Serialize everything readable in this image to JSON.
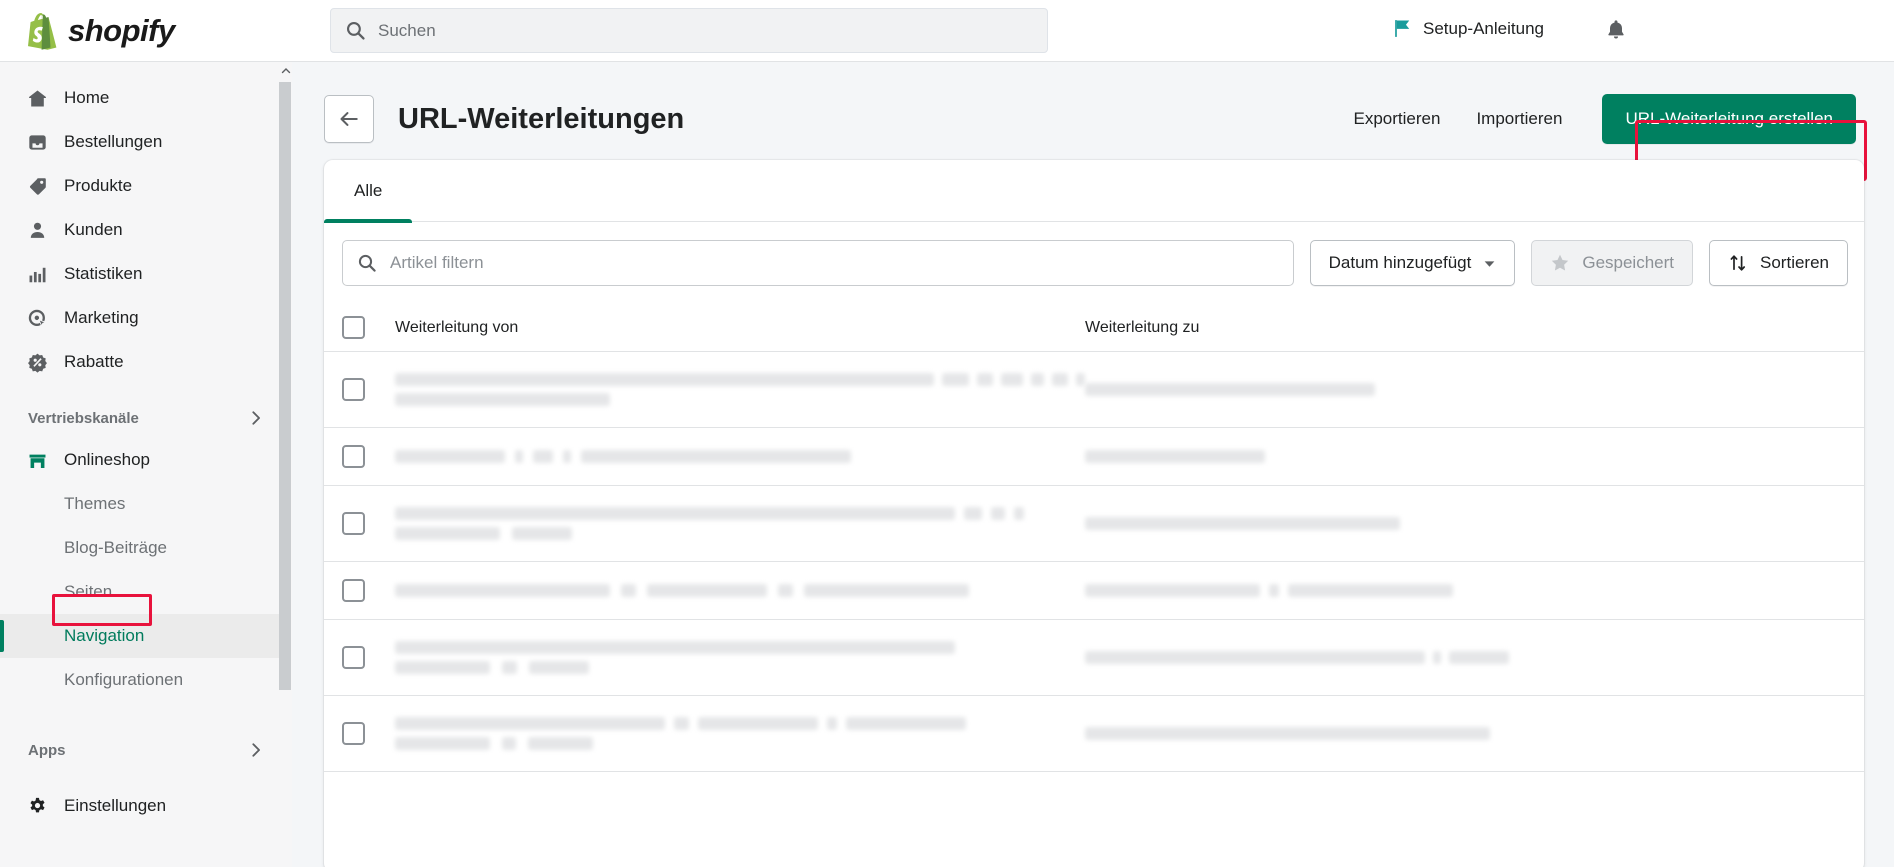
{
  "topbar": {
    "brand_name": "shopify",
    "brand_icon": "shopify-bag-icon",
    "search_placeholder": "Suchen",
    "search_icon": "search-icon",
    "setup_guide_label": "Setup-Anleitung",
    "flag_icon": "flag-icon",
    "notifications_icon": "bell-icon",
    "flag_color": "#1a9c9c"
  },
  "sidebar": {
    "items": [
      {
        "label": "Home",
        "icon": "home-icon"
      },
      {
        "label": "Bestellungen",
        "icon": "orders-inbox-icon"
      },
      {
        "label": "Produkte",
        "icon": "product-tag-icon"
      },
      {
        "label": "Kunden",
        "icon": "customer-person-icon"
      },
      {
        "label": "Statistiken",
        "icon": "analytics-bars-icon"
      },
      {
        "label": "Marketing",
        "icon": "marketing-target-icon"
      },
      {
        "label": "Rabatte",
        "icon": "discount-percent-icon"
      }
    ],
    "sales_channels": {
      "label": "Vertriebskanäle",
      "chevron_icon": "chevron-right-icon",
      "store": {
        "label": "Onlineshop",
        "icon": "online-store-icon",
        "color": "#008060"
      },
      "sub_items": [
        {
          "label": "Themes",
          "active": false
        },
        {
          "label": "Blog-Beiträge",
          "active": false
        },
        {
          "label": "Seiten",
          "active": false
        },
        {
          "label": "Navigation",
          "active": true
        },
        {
          "label": "Konfigurationen",
          "active": false
        }
      ]
    },
    "apps": {
      "label": "Apps",
      "chevron_icon": "chevron-right-icon"
    },
    "settings": {
      "label": "Einstellungen",
      "icon": "gear-icon"
    },
    "scrollbar": {
      "up_arrow_icon": "chevron-up-icon"
    },
    "annotation_color": "#e8123c",
    "active_color": "#007b5c"
  },
  "page": {
    "back_icon": "arrow-left-icon",
    "title": "URL-Weiterleitungen",
    "export_label": "Exportieren",
    "import_label": "Importieren",
    "create_label": "URL-Weiterleitung erstellen",
    "primary_color": "#008060",
    "annotation_color": "#e8123c"
  },
  "card": {
    "tabs": [
      {
        "label": "Alle",
        "active": true
      }
    ],
    "filter": {
      "placeholder": "Artikel filtern",
      "search_icon": "search-icon",
      "date_button_label": "Datum hinzugefügt",
      "date_caret_icon": "caret-down-icon",
      "saved_button_label": "Gespeichert",
      "saved_star_icon": "star-icon",
      "sort_button_label": "Sortieren",
      "sort_icon": "sort-arrows-icon"
    },
    "table": {
      "select_all_checkbox": "checkbox",
      "columns": [
        "Weiterleitung von",
        "Weiterleitung zu"
      ],
      "rows": [
        {
          "from_widths": [
            600,
            30,
            18,
            25,
            14,
            18,
            10,
            215
          ],
          "to_widths": [
            290
          ]
        },
        {
          "from_widths": [
            110,
            8,
            20,
            8,
            270
          ],
          "to_widths": [
            180
          ]
        },
        {
          "from_widths": [
            640,
            18,
            14,
            10,
            105,
            60
          ],
          "to_widths": [
            315
          ]
        },
        {
          "from_widths": [
            215,
            15,
            120,
            15,
            165
          ],
          "to_widths": [
            175,
            10,
            165
          ]
        },
        {
          "from_widths": [
            560,
            95,
            15,
            60
          ],
          "to_widths": [
            340,
            8,
            60
          ]
        },
        {
          "from_widths": [
            270,
            15,
            120,
            10,
            120,
            95,
            14,
            65
          ],
          "to_widths": [
            405
          ]
        }
      ]
    }
  }
}
